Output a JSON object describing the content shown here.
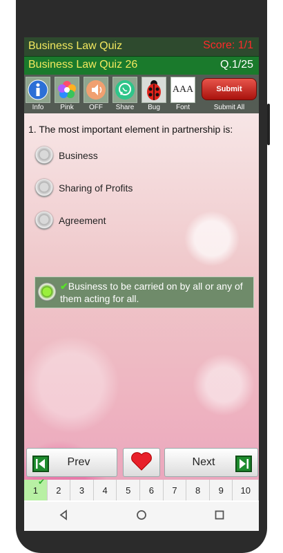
{
  "header": {
    "app_title": "Business Law Quiz",
    "score": "Score: 1/1",
    "quiz_title": "Business Law Quiz 26",
    "question_counter": "Q.1/25"
  },
  "toolbar": {
    "info": "Info",
    "pink": "Pink",
    "off": "OFF",
    "share": "Share",
    "bug": "Bug",
    "font": "Font",
    "font_icon_text": "AAA",
    "submit": "Submit",
    "submit_all": "Submit All"
  },
  "question": {
    "text": "1. The most important element in partnership is:",
    "options": [
      "Business",
      "Sharing of Profits",
      "Agreement",
      "Business to be carried on by all or any of them acting for all."
    ],
    "check_mark": "✔"
  },
  "nav": {
    "prev": "Prev",
    "next": "Next"
  },
  "pages": [
    "1",
    "2",
    "3",
    "4",
    "5",
    "6",
    "7",
    "8",
    "9",
    "10"
  ],
  "colors": {
    "accent_green": "#1a7a2c",
    "score_red": "#ff2a2a",
    "title_yellow": "#f3e95f"
  }
}
